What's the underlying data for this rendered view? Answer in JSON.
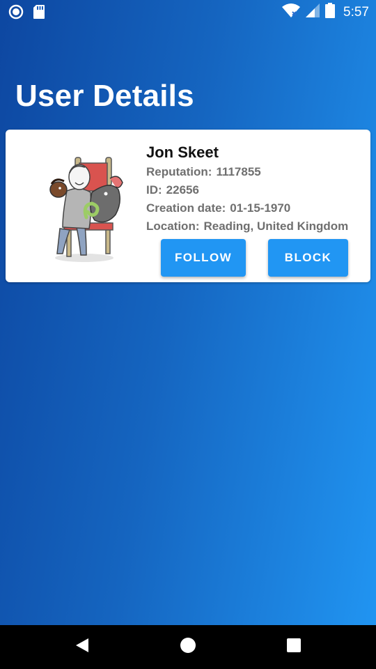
{
  "status_bar": {
    "time": "5:57",
    "icons_left": [
      "circle-notification-icon",
      "sd-card-icon"
    ],
    "icons_right": [
      "wifi-icon",
      "cell-signal-icon",
      "battery-icon"
    ]
  },
  "page": {
    "title": "User Details"
  },
  "user": {
    "name": "Jon Skeet",
    "reputation_label": "Reputation:",
    "reputation": "1117855",
    "id_label": "ID:",
    "id": "22656",
    "creation_label": "Creation date:",
    "creation_date": "01-15-1970",
    "location_label": "Location:",
    "location": "Reading, United Kingdom"
  },
  "actions": {
    "follow_label": "FOLLOW",
    "block_label": "BLOCK"
  },
  "colors": {
    "gradient_start": "#0d47a1",
    "gradient_end": "#2196f3",
    "button": "#2196f3",
    "card": "#ffffff",
    "detail_text": "#6f6f6f"
  },
  "nav_bar": {
    "icons": [
      "back-icon",
      "home-icon",
      "recent-apps-icon"
    ]
  }
}
